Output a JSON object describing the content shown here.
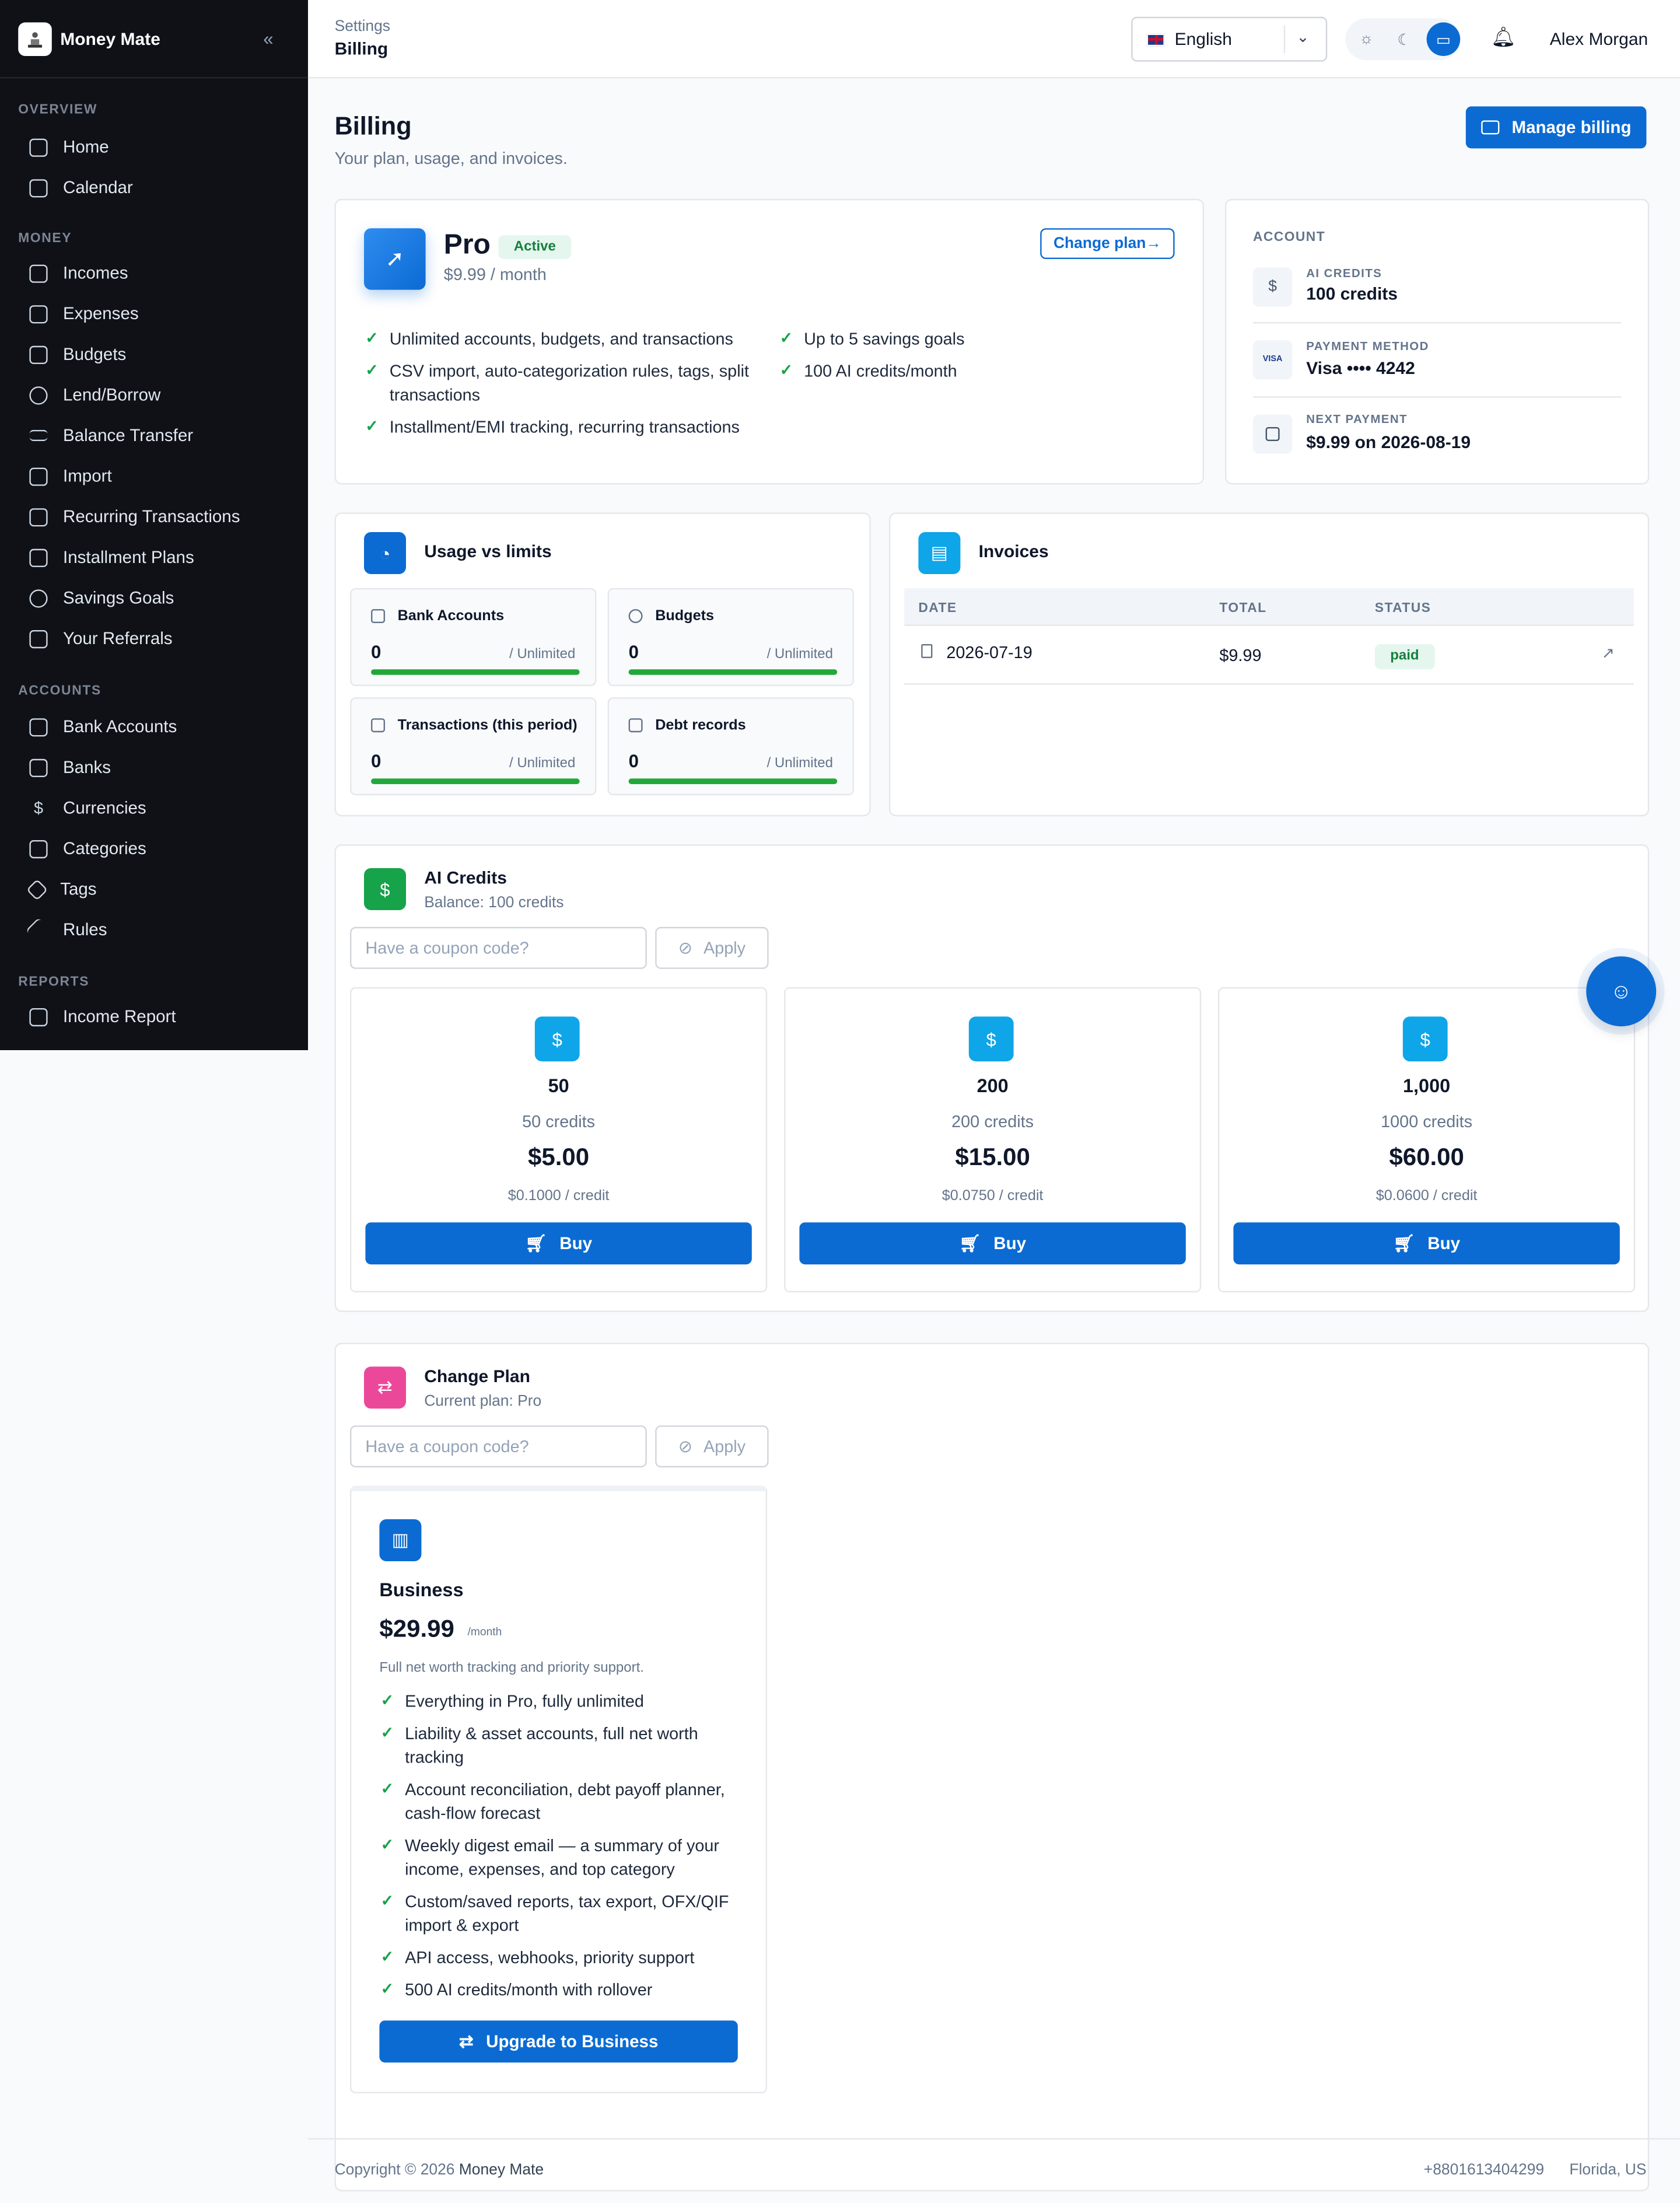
{
  "app": {
    "name": "Money Mate"
  },
  "sidebar": {
    "sections": [
      {
        "title": "OVERVIEW",
        "items": [
          {
            "label": "Home",
            "icon": "home-icon"
          },
          {
            "label": "Calendar",
            "icon": "calendar-icon"
          }
        ]
      },
      {
        "title": "MONEY",
        "items": [
          {
            "label": "Incomes",
            "icon": "incomes-icon"
          },
          {
            "label": "Expenses",
            "icon": "expenses-icon"
          },
          {
            "label": "Budgets",
            "icon": "budgets-icon"
          },
          {
            "label": "Lend/Borrow",
            "icon": "lend-borrow-icon"
          },
          {
            "label": "Balance Transfer",
            "icon": "balance-transfer-icon"
          },
          {
            "label": "Import",
            "icon": "import-icon"
          },
          {
            "label": "Recurring Transactions",
            "icon": "recurring-icon"
          },
          {
            "label": "Installment Plans",
            "icon": "installment-icon"
          },
          {
            "label": "Savings Goals",
            "icon": "piggy-bank-icon"
          },
          {
            "label": "Your Referrals",
            "icon": "gift-icon"
          }
        ]
      },
      {
        "title": "ACCOUNTS",
        "items": [
          {
            "label": "Bank Accounts",
            "icon": "bank-account-icon"
          },
          {
            "label": "Banks",
            "icon": "bank-icon"
          },
          {
            "label": "Currencies",
            "icon": "dollar-icon"
          },
          {
            "label": "Categories",
            "icon": "categories-icon"
          },
          {
            "label": "Tags",
            "icon": "tag-icon"
          },
          {
            "label": "Rules",
            "icon": "wand-icon"
          }
        ]
      },
      {
        "title": "REPORTS",
        "items": [
          {
            "label": "Income Report",
            "icon": "report-icon"
          }
        ]
      }
    ]
  },
  "topbar": {
    "breadcrumb_parent": "Settings",
    "breadcrumb_current": "Billing",
    "language": "English",
    "user": "Alex Morgan"
  },
  "page": {
    "title": "Billing",
    "subtitle": "Your plan, usage, and invoices.",
    "manage_billing": "Manage billing"
  },
  "plan": {
    "name": "Pro",
    "status": "Active",
    "price": "$9.99 / month",
    "change_plan": "Change plan",
    "features_left": [
      "Unlimited accounts, budgets, and transactions",
      "CSV import, auto-categorization rules, tags, split transactions",
      "Installment/EMI tracking, recurring transactions"
    ],
    "features_right": [
      "Up to 5 savings goals",
      "100 AI credits/month"
    ]
  },
  "account": {
    "title": "ACCOUNT",
    "ai_credits_label": "AI CREDITS",
    "ai_credits_value": "100 credits",
    "payment_label": "PAYMENT METHOD",
    "payment_value": "Visa •••• 4242",
    "card_brand": "VISA",
    "next_label": "NEXT PAYMENT",
    "next_value": "$9.99 on 2026-08-19"
  },
  "usage": {
    "title": "Usage vs limits",
    "items": [
      {
        "label": "Bank Accounts",
        "value": "0",
        "limit": "/ Unlimited"
      },
      {
        "label": "Budgets",
        "value": "0",
        "limit": "/ Unlimited"
      },
      {
        "label": "Transactions (this period)",
        "value": "0",
        "limit": "/ Unlimited"
      },
      {
        "label": "Debt records",
        "value": "0",
        "limit": "/ Unlimited"
      }
    ]
  },
  "invoices": {
    "title": "Invoices",
    "columns": [
      "DATE",
      "TOTAL",
      "STATUS"
    ],
    "rows": [
      {
        "date": "2026-07-19",
        "total": "$9.99",
        "status": "paid"
      }
    ]
  },
  "ai_credits": {
    "title": "AI Credits",
    "balance": "Balance: 100 credits",
    "coupon_placeholder": "Have a coupon code?",
    "apply": "Apply",
    "packs": [
      {
        "name": "50",
        "credits": "50 credits",
        "price": "$5.00",
        "per": "$0.1000 / credit",
        "buy": "Buy"
      },
      {
        "name": "200",
        "credits": "200 credits",
        "price": "$15.00",
        "per": "$0.0750 / credit",
        "buy": "Buy"
      },
      {
        "name": "1,000",
        "credits": "1000 credits",
        "price": "$60.00",
        "per": "$0.0600 / credit",
        "buy": "Buy"
      }
    ]
  },
  "change_plan": {
    "title": "Change Plan",
    "current": "Current plan: Pro",
    "coupon_placeholder": "Have a coupon code?",
    "apply": "Apply",
    "offer": {
      "name": "Business",
      "price": "$29.99",
      "period": "/month",
      "description": "Full net worth tracking and priority support.",
      "features": [
        "Everything in Pro, fully unlimited",
        "Liability & asset accounts, full net worth tracking",
        "Account reconciliation, debt payoff planner, cash-flow forecast",
        "Weekly digest email — a summary of your income, expenses, and top category",
        "Custom/saved reports, tax export, OFX/QIF import & export",
        "API access, webhooks, priority support",
        "500 AI credits/month with rollover"
      ],
      "cta": "Upgrade to Business"
    }
  },
  "footer": {
    "copyright_prefix": "Copyright © 2026",
    "brand": "Money Mate",
    "phone": "+8801613404299",
    "location": "Florida, US"
  },
  "colors": {
    "primary": "#0b6bd3",
    "success": "#16a34a",
    "sidebar": "#0f1117"
  }
}
